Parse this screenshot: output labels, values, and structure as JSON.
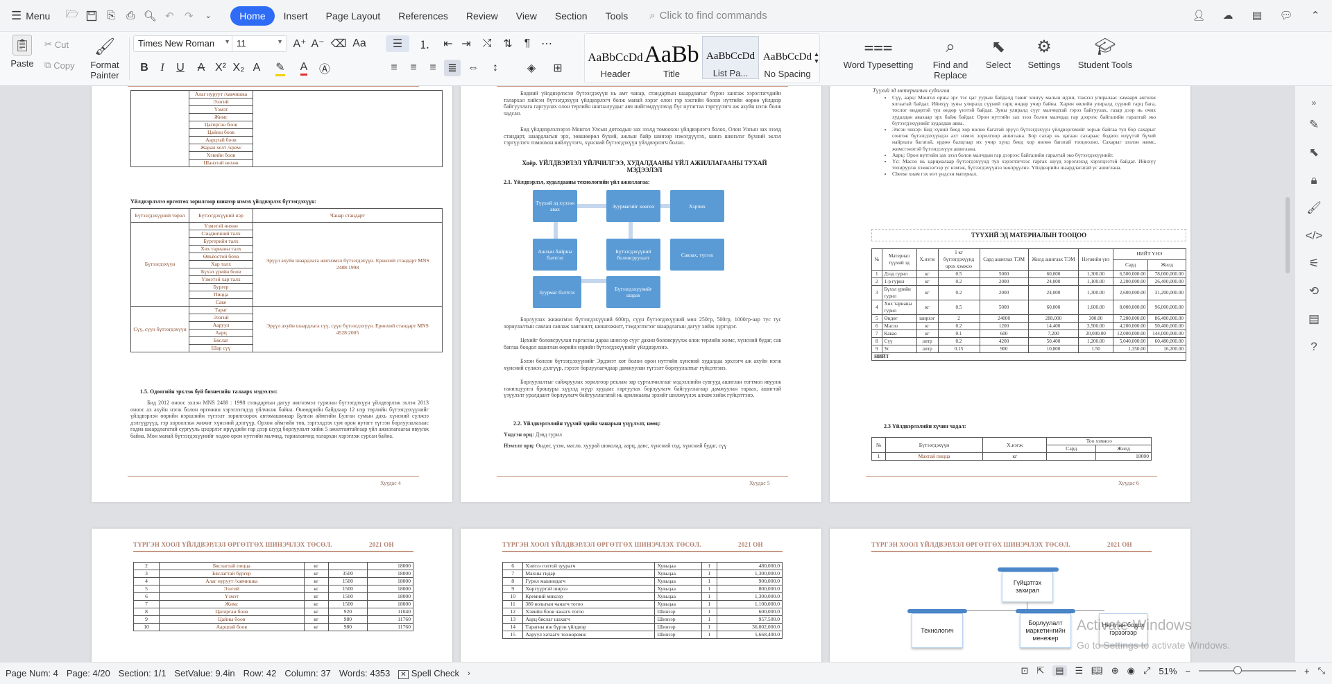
{
  "menubar": {
    "menu_label": "Menu",
    "tabs": [
      {
        "label": "Home",
        "active": true
      },
      {
        "label": "Insert"
      },
      {
        "label": "Page Layout"
      },
      {
        "label": "References"
      },
      {
        "label": "Review"
      },
      {
        "label": "View"
      },
      {
        "label": "Section"
      },
      {
        "label": "Tools"
      }
    ],
    "search_placeholder": "Click to find commands"
  },
  "ribbon": {
    "paste": "Paste",
    "cut": "Cut",
    "copy": "Copy",
    "format_painter": "Format Painter",
    "font_name": "Times New Roman",
    "font_size": "11",
    "styles": [
      {
        "preview": "AaBbCcDd",
        "label": "Header"
      },
      {
        "preview": "AaBb",
        "label": "Title"
      },
      {
        "preview": "AaBbCcDd",
        "label": "List Pa..."
      },
      {
        "preview": "AaBbCcDd",
        "label": "No Spacing"
      }
    ],
    "word_typesetting": "Word Typesetting",
    "find_replace": "Find and Replace",
    "select": "Select",
    "settings": "Settings",
    "student_tools": "Student Tools"
  },
  "page4": {
    "top_table": [
      "Алаг нуруут /хавчишка",
      "Бяслагтай пицца",
      "Ээзгий",
      "Ялтсан хадмал",
      "Ялтсан ааруул",
      "Тамхин гэдэс",
      "Эвэрцгий",
      "Шар сүү",
      "Хоолны хиамтай",
      "Алаг нуруут",
      "Бяслаг",
      "Шанзтай өнхөө"
    ],
    "top_table_visible": [
      "Алаг нуруут /хавчишка",
      "Ээзгий",
      "Үзмэт",
      "Жимс",
      "Цагирган боов",
      "Цайны боов",
      "Аарцтай боов",
      "Жаран хелт /крем/",
      "Хэвийн боов",
      "Шанзтай өнхөө"
    ],
    "section_title": "Үйлдвэрлэлээ өргөтгөх зорилгоор шинээр нэмэх үйлдвэрлэх бүтээгдэхүүн:",
    "table_headers": [
      "Бүтээгдэхүүний төрөл",
      "Бүтээгдэхүүний нэр",
      "Чанар стандарт"
    ],
    "group1": "Бүтээгдэхүүн",
    "group1_items": [
      "Үзмэтэй өнхөө",
      "Сэндвичний талх",
      "Бургерийн талх",
      "Хөх тарианы талх",
      "Өвъёостой боов",
      "Хар талх",
      "Бүхэл үрийн боов",
      "Үзмэтэй хар талх",
      "Бургер",
      "Пицца",
      "Саке"
    ],
    "group1_std": "Эрүүл ахуйн шаардлага жигнэмэл бүтээгдэхүүн. Ерөнхий стандарт MNS 2488:1998",
    "group2": "Сүү, сүүн бүтээгдэхүүн",
    "group2_items": [
      "Тараг",
      "Ээзгий",
      "Ааруул",
      "Аарц",
      "Бяслаг",
      "Шар сүү"
    ],
    "group2_std": "Эрүүл ахуйн шаардлага сүү, сүүн бүтээгдэхүүн. Ерөнхий стандарт MNS 4528:2005",
    "subhead": "1.5. Одоогийн эрхлэж буй бизнесийн талаарх мэдээлэл:",
    "body": "Бид 2012 оноос эхлэн MNS 2488 : 1998 стандартын дагуу жигнэмэл гурилан бүтээгдэхүүн үйлдвэрлэж эхлэн 2013 оноос ах ахуйн нэгж болон өргөжин хэрэглэгчдэд үйлчилж байна. Өнөөдрийн байдлаар 12 нэр төрлийн бүтээгдэхүүнийг үйлдвэрлэн өөрийн нэршлийн түгээлт зорилгоорох автомашинаар Булган аймгийн Булган сумын дахь хүнсний сүлжээ дэлгүүрүүд, гэр хороолльн жижиг хүнсний дэлгүүр, Орхон аймгийн төв, зэргэлдээх сум орон нутагт түгээн борлуулалахаас гадна шаардлагатай сургууль цэцэрлэг ирүүдийн гар дээр шууд борлуулалт хийж 5 ажилтантайгаар үйл ажиллагаагаа явуулж байна. Мөн манай бүтээгдэхүүнийг хөдөө орон нутгийн малчид, тариаланчид талархан хэрэглэж сурсан байна.",
    "footer": "Хуудас 4"
  },
  "page5": {
    "para1": "Бидний үйлдвэрлэсэн бүтээгдэхүүн нь амт чанар, стандартын шаардлагыг бүрэн хангаж хэрэглэгчдийн талархал хийсэн бүтээгдэхүүн үйлдвэрлэгч болж манай хэрэг олон гэр хэсгийн болон нутгийн өөрөө үйлдвэр байгууллага гаргуулах олон терлийн шагналуудыг авч нийгэмдүүлэхэд бүс нутагтаа тэргүүлэгч аж ахуйн нэгж болж чадсан.",
    "para2": "Бид үйлдвэрлэлээрээ Монгол Улсын дотоодын зах зээлд томоохон үйлдвэрлэгч болох, Олон Улсын зах зээлд стандарт, шаардлагын эрх, зөвшөөрөл бүхий, ажлын байр шинээр нэмэгдүүлэх, шинэ шинэлэг бүхний эклэл тэргүүлэгч томоохон нийлүүлэгч, хүнсний бүтээгдэхүүн үйлдвэрлэгч болно.",
    "chapter": "Хоёр. ҮЙЛДВЭРЛЭЛ ҮЙЛЧИЛГЭЭ, ХУДАЛДААНЫ ҮЙЛ АЖИЛЛАГААНЫ ТУХАЙ МЭДЭЭЛЭЛ",
    "sub21": "2.1. Үйлдвэрлэл, худалдааны технологийн үйл ажиллагаа:",
    "flow": [
      "Түүхий эд хүлээн авах",
      "Зуурмагийг хөөгөх",
      "Хэрчих",
      "Ажлын байрны бэлтгэл",
      "Бүтээгдэхүүний боловсруулалт",
      "Савлах, түгээх",
      "Зуурмаг бэлтгэх",
      "Бүтээгдэхүүнийг шарах"
    ],
    "para3": "Борлуулах жижигмэл бүтээгдэхүүний 600гр, сүүн бүтээгдэхүүний мөн 250гр, 500гр, 1000гр-аар тус тус зориулалтын савлан савлаж хаягжилт, шошгожилт, тэмдэглэгээг шаардлагын дагуу хийж хүргэдэг.",
    "para4": "Цехийг боловсруулан гаргасны дараа шинээр сүүг дахин боловсруулж олон терлийн жимс, хүнсний будаг, сав баглаа боодол ашиглан өөрийн нэрийн бүтээгдэхүүнийг үйлдвэрлэнэ.",
    "para5": "Бэлэн болсон бүтээгдэхүүнийг Эрдэнэт хот болон орон нутгийн хүнсний худалдаа эрхлэгч аж ахуйн нэгж хүнсний сүлжээ дэлгүүр, гэрээт борлуулагчдаар дамжуулан түгээлт борлуулалтыг гүйцэтгэнэ.",
    "para6": "Борлуулалтыг сайжруулах зорилгоор реклам зар сурталчилгааг мэдээллийн сувгууд ашиглан тогтмол явуулж танилцуулга брошуры хүүхэд нүүр хуудаас гаргуулах борлуулагч байгууллагаар дамжуулан тараах, ашигтай үзүүлэлт уралдаант борлуулагч байгууллагатай нь арилжааны эрхийг шилжүүлэх алхам хийж гүйцэтгэнэ.",
    "sub22": "2.2. Үйлдвэрлэлийн түүхий эдийн чанарын үзүүлэлт, нөөц:",
    "main_raw_label": "Үндсэн орц:",
    "main_raw": "Дэвд гурил",
    "extra_label": "Нэмэлт орц:",
    "extra": "Өндөг, үзэм, масло, хуурай шоколад, аарц, давс, хүнсний сод, хүнсний будаг, сүү",
    "footer": "Хуудас 5"
  },
  "page6": {
    "intro_head": "Түүхий эд материалын судалгаа",
    "bullets": [
      "Сүү, аарц: Монгол орны эрс тэс цаг уурын байдалд тавиг хошуу малын идэш, тэжээл улиралаас хамаарч ангилж ялгаатай байдаг. Ийнхүү зуны улиралд сүүний гарц өндөр учир байна. Харин өвлийн улиралд сүүний гарц бага, тослог өндөртэй тул өндөр үнэтэй байдаг. Зуны улиралд сүүг малчидтай гэрээ байгуулах, газар дээр нь очих худалдан авахаар эрх байж байдаг. Орон нутгийн зах зээл болон малчдад гар дээрээс байгалийн гаралтай эко бүтээгдэхүүнийг худалдан авна.",
      "Элсэн чихэр: Бид хүний биед хор нөлөө багатай эрүүл бүтээгдэхүүн үйлдвэрлэхийг зорьж байгаа тул бор сахарыг сонгож бүтээгдэхүүндээ ахт нэмэх зорилгоор ашиглана. Бор сахар нь цагаан сахараас бодвоо илүүтэй бүхий найрлага багатай, ердөө балцгаар их учир хүнд биед хор нөлөө багатай тооцоолно. Сахарыг зээлэн жимс, жимсгэнэтэй бүтээгдэхүүн ашиглана.",
      "Аарц: Орон нутгийн зах зээл болон малчдын гар дээрээс байгалийн гаралтай эко бүтээгдэхүүнийг.",
      "Үс: Масло нь царцмалаар бүтээгдэхүүнд тул хэрэглэгчээс гаргах шууд хэрэглэхэд хэрэгцээтэй байдаг. Ийнхүү тохируулж хэмжээгээр үс нэмэж, бүтээгдэхүүнээ зөөлрүүлнэ. Үйлдвэрийн шаардлагатай ус ашиглана.",
      "Cheese хиам гэх мэт үндсэн материал."
    ],
    "raw_title": "ТҮҮХИЙ ЭД МАТЕРИАЛЫН ТООЦОО",
    "raw_headers": [
      "№",
      "Материал түүхий эд",
      "Х.нэгж",
      "1 кг бүтээгдэхүүнд орох хэмжээ",
      "Сард ашиглах ТЭМ",
      "Жилд ашиглах ТЭМ",
      "Нэгжийн үнэ",
      "НИЙТ ҮНЭ",
      "Сард",
      "Жилд"
    ],
    "raw_rows": [
      [
        "1",
        "Дээд гурил",
        "кг",
        "0.5",
        "5000",
        "60,000",
        "1,300.00",
        "6,500,000.00",
        "78,000,000.00"
      ],
      [
        "2",
        "1-р гурил",
        "кг",
        "0.2",
        "2000",
        "24,000",
        "1,100.00",
        "2,200,000.00",
        "26,400,000.00"
      ],
      [
        "3",
        "Бүхэл үрийн гурил",
        "кг",
        "0.2",
        "2000",
        "24,000",
        "1,300.00",
        "2,600,000.00",
        "31,200,000.00"
      ],
      [
        "4",
        "Хөх тарианы гурил",
        "кг",
        "0.5",
        "5000",
        "60,000",
        "1,600.00",
        "8,000,000.00",
        "96,000,000.00"
      ],
      [
        "5",
        "Өндөг",
        "ширхэг",
        "2",
        "24000",
        "288,000",
        "300.00",
        "7,200,000.00",
        "86,400,000.00"
      ],
      [
        "6",
        "Масло",
        "кг",
        "0.2",
        "1200",
        "14,400",
        "3,500.00",
        "4,200,000.00",
        "50,400,000.00"
      ],
      [
        "7",
        "Какао",
        "кг",
        "0.1",
        "600",
        "7,200",
        "20,000.00",
        "12,000,000.00",
        "144,000,000.00"
      ],
      [
        "8",
        "Сүү",
        "литр",
        "0.2",
        "4200",
        "50,400",
        "1,200.00",
        "5,040,000.00",
        "60,480,000.00"
      ],
      [
        "9",
        "Ус",
        "литр",
        "0.15",
        "900",
        "10,800",
        "1.50",
        "1,350.00",
        "16,200.00"
      ]
    ],
    "raw_total": "НИЙТ",
    "sub23": "2.3 Үйлдвэрлэлийн хүчин чадал:",
    "cap_headers": [
      "№",
      "Бүтээгдэхүүн",
      "Х.нэгж",
      "Тоо хэмжээ",
      "Сард",
      "Жилд"
    ],
    "cap_row": [
      "1",
      "Махтай пицца",
      "кг",
      "",
      "18000"
    ],
    "footer": "Хуудас 6"
  },
  "page7": {
    "header": "ТҮРГЭН ХООЛ ҮЙЛДВЭРЛЭЛ ӨРГӨТГӨХ ШИНЭЧЛЭХ ТӨСӨЛ.",
    "year": "2021 ОН",
    "rows": [
      [
        "2",
        "Бяслагтай пицца",
        "кг",
        "",
        "18000"
      ],
      [
        "3",
        "Бяслагтай бургер",
        "кг",
        "3500",
        "18000"
      ],
      [
        "4",
        "Алаг нуруут /хавчишка",
        "кг",
        "1500",
        "18000"
      ],
      [
        "5",
        "Ээзгий",
        "кг",
        "1500",
        "18000"
      ],
      [
        "6",
        "Үзмэт",
        "кг",
        "1500",
        "18000"
      ],
      [
        "7",
        "Жимс",
        "кг",
        "1500",
        "18000"
      ],
      [
        "8",
        "Цагирган боов",
        "кг",
        "920",
        "11040"
      ],
      [
        "9",
        "Цайны боов",
        "кг",
        "980",
        "11760"
      ],
      [
        "10",
        "Аарцтай боов",
        "кг",
        "980",
        "11760"
      ]
    ]
  },
  "page8": {
    "header": "ТҮРГЭН ХООЛ ҮЙЛДВЭРЛЭЛ ӨРГӨТГӨХ ШИНЭЧЛЭХ ТӨСӨЛ.",
    "year": "2021 ОН",
    "rows": [
      [
        "6",
        "Хэвтээ голтой зуурагч",
        "Хувьцаа",
        "1",
        "480,000.0"
      ],
      [
        "7",
        "Махны гидар",
        "Хувьцаа",
        "1",
        "1,300,000.0"
      ],
      [
        "8",
        "Гурил машиндагч",
        "Хувьцаа",
        "1",
        "900,000.0"
      ],
      [
        "9",
        "Хөргүүртэй ширээ",
        "Хувьцаа",
        "1",
        "800,000.0"
      ],
      [
        "10",
        "Кремний миксер",
        "Хувьцаа",
        "1",
        "1,300,000.0"
      ],
      [
        "11",
        "380 вольтын чанагч тогоо",
        "Хувьцаа",
        "1",
        "1,100,000.0"
      ],
      [
        "12",
        "Хэвийн боов чанагч тогоо",
        "Шинээр",
        "1",
        "600,000.0"
      ],
      [
        "13",
        "Аарц бяслаг шахагч",
        "Шинээр",
        "1",
        "957,500.0"
      ],
      [
        "14",
        "Тарагны иж бүрэн үйлдвэр",
        "Шинээр",
        "1",
        "36,002,000.0"
      ],
      [
        "15",
        "Ааруул хатаагч төхөөрөмж",
        "Шинээр",
        "1",
        "5,668,400.0"
      ]
    ]
  },
  "page9": {
    "header": "ТҮРГЭН ХООЛ ҮЙЛДВЭРЛЭЛ ӨРГӨТГӨХ ШИНЭЧЛЭХ ТӨСӨЛ.",
    "year": "2021 ОН",
    "org": [
      "Гүйцэтгэх захирал",
      "Технологич",
      "Борлуулалт маркетингийн менежер",
      "Нягтлан бодох гэрээгээр"
    ]
  },
  "watermark": {
    "line1": "Activate Windows",
    "line2": "Go to Settings to activate Windows."
  },
  "status": {
    "page_num": "Page Num: 4",
    "page": "Page: 4/20",
    "section": "Section: 1/1",
    "setvalue": "SetValue: 9.4in",
    "row": "Row: 42",
    "column": "Column: 37",
    "words": "Words: 4353",
    "spell": "Spell Check",
    "zoom": "51%"
  }
}
